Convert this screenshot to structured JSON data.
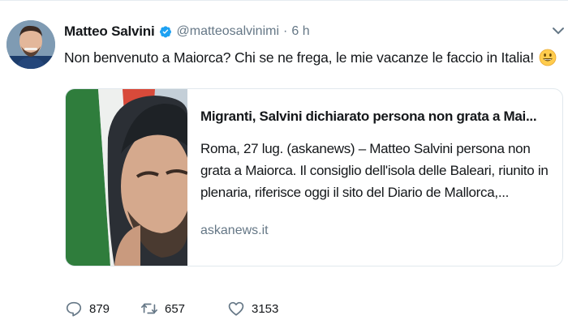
{
  "tweet": {
    "author_name": "Matteo Salvini",
    "handle": "@matteosalvinimi",
    "separator": "·",
    "time": "6 h",
    "text": "Non benvenuto a Maiorca? Chi se ne frega, le mie vacanze le faccio in Italia!"
  },
  "card": {
    "title": "Migranti, Salvini dichiarato persona non grata a Mai...",
    "description": "Roma, 27 lug. (askanews) – Matteo Salvini persona non grata a Maiorca. Il consiglio dell'isola delle Baleari, riunito in plenaria, riferisce oggi il sito del Diario de Mallorca,...",
    "domain": "askanews.it"
  },
  "actions": {
    "replies": "879",
    "retweets": "657",
    "likes": "3153"
  },
  "colors": {
    "text": "#14171a",
    "secondary": "#657786",
    "verified": "#1da1f2",
    "border": "#e1e8ed"
  },
  "icons": {
    "verified": "verified-badge-icon",
    "caret": "chevron-down-icon",
    "emoji": "smiley-emoji-icon",
    "reply": "reply-icon",
    "retweet": "retweet-icon",
    "like": "heart-icon"
  }
}
